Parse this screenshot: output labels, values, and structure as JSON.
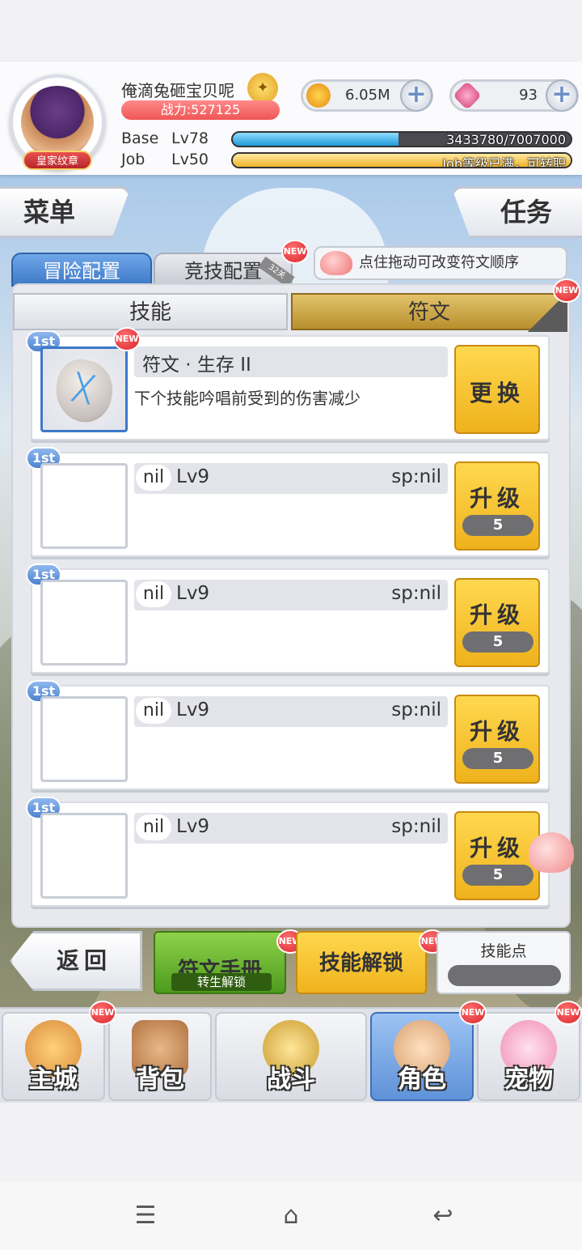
{
  "player": {
    "name": "俺滴兔砸宝贝呢",
    "power": "战力:527125",
    "badge": "皇家纹章"
  },
  "currency": {
    "gold": "6.05M",
    "gems": "93",
    "plus": "+"
  },
  "levels": {
    "base_label": "Base",
    "base_level": "Lv78",
    "base_exp": "3433780/7007000",
    "base_progress": 0.49,
    "job_label": "Job",
    "job_level": "Lv50",
    "job_status": "Job等级已满，可转职",
    "job_progress": 1.0
  },
  "side": {
    "menu": "菜单",
    "task": "任务"
  },
  "tabs": {
    "adventure": "冒险配置",
    "arena": "竞技配置",
    "arena_ribbon": "32关",
    "hint": "点住拖动可改变符文顺序"
  },
  "subtabs": {
    "skill": "技能",
    "rune": "符文",
    "rune_lock": "转生解锁"
  },
  "new_label": "NEW",
  "rows": [
    {
      "rank": "1st",
      "rune_name": "符文 · 生存 II",
      "rune_desc": "下个技能吟唱前受到的伤害减少",
      "action": "更换"
    },
    {
      "rank": "1st",
      "nil": "nil",
      "lv": "Lv9",
      "sp": "sp:nil",
      "action": "升级",
      "cost": "5"
    },
    {
      "rank": "1st",
      "nil": "nil",
      "lv": "Lv9",
      "sp": "sp:nil",
      "action": "升级",
      "cost": "5"
    },
    {
      "rank": "1st",
      "nil": "nil",
      "lv": "Lv9",
      "sp": "sp:nil",
      "action": "升级",
      "cost": "5"
    },
    {
      "rank": "1st",
      "nil": "nil",
      "lv": "Lv9",
      "sp": "sp:nil",
      "action": "升级",
      "cost": "5"
    }
  ],
  "bottom": {
    "back": "返回",
    "manual": "符文手册",
    "manual_lock": "转生解锁",
    "unlock": "技能解锁",
    "skill_points": "技能点"
  },
  "nav": [
    {
      "label": "主城"
    },
    {
      "label": "背包"
    },
    {
      "label": "战斗"
    },
    {
      "label": "角色"
    },
    {
      "label": "宠物"
    }
  ],
  "system": {
    "menu_icon": "☰",
    "home_icon": "⌂",
    "back_icon": "↩"
  }
}
